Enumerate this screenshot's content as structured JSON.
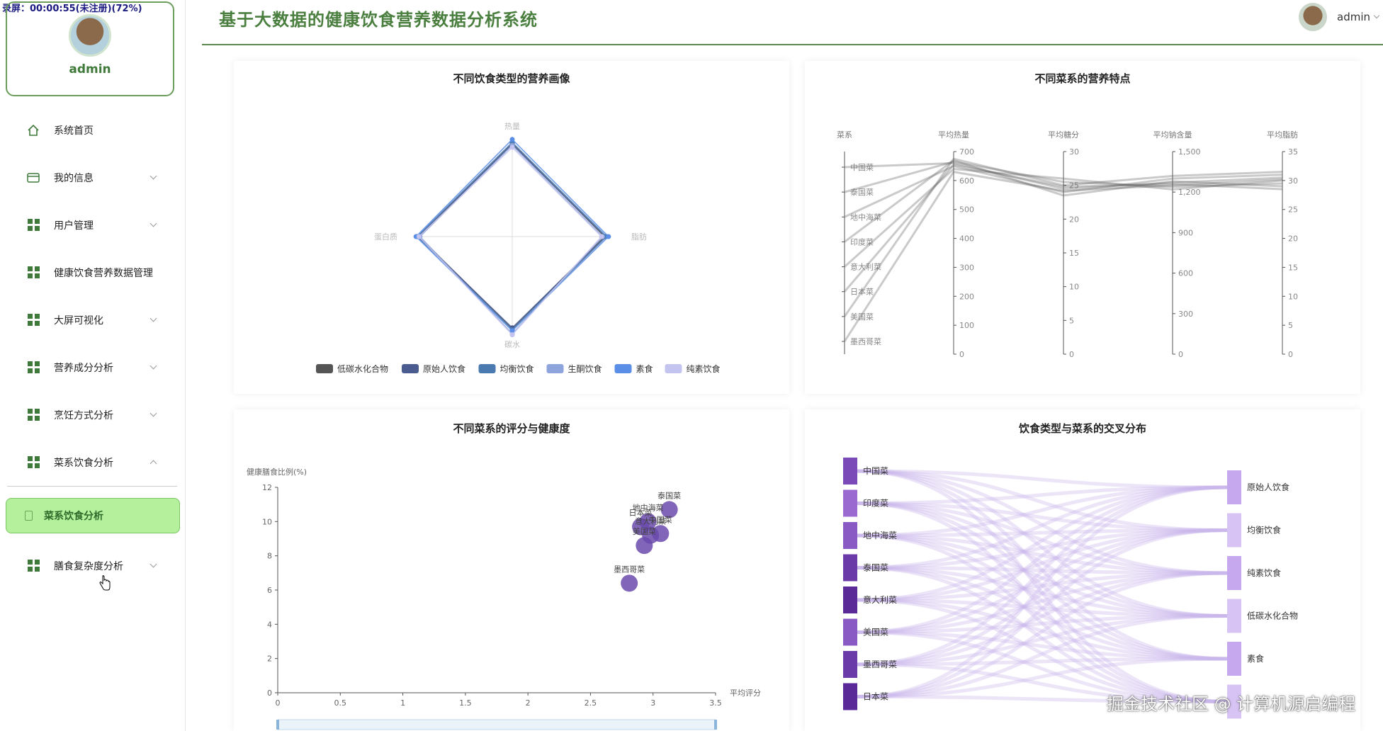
{
  "recording_overlay": "录屏：00:00:55(未注册)(72%)",
  "profile": {
    "name": "admin"
  },
  "menu": {
    "items": [
      {
        "label": "系统首页",
        "icon": "home-icon"
      },
      {
        "label": "我的信息",
        "icon": "card-icon"
      },
      {
        "label": "用户管理",
        "icon": "grid-icon"
      },
      {
        "label": "健康饮食营养数据管理",
        "icon": "grid-icon"
      },
      {
        "label": "大屏可视化",
        "icon": "grid-icon"
      },
      {
        "label": "营养成分分析",
        "icon": "grid-icon"
      },
      {
        "label": "烹饪方式分析",
        "icon": "grid-icon"
      },
      {
        "label": "菜系饮食分析",
        "icon": "grid-icon"
      },
      {
        "label": "膳食复杂度分析",
        "icon": "grid-icon"
      }
    ],
    "active_sub": "菜系饮食分析"
  },
  "header": {
    "title": "基于大数据的健康饮食营养数据分析系统",
    "user": "admin"
  },
  "watermark": "掘金技术社区 @ 计算机源启编程",
  "colors": {
    "accent": "#4a7f3f",
    "active_bg": "#b5f09c",
    "scatter": "#6a4aad"
  },
  "chart_data": [
    {
      "type": "radar",
      "title": "不同饮食类型的营养画像",
      "indicators": [
        "热量",
        "脂肪",
        "碳水",
        "蛋白质"
      ],
      "legend": [
        "低碳水化合物",
        "原始人饮食",
        "均衡饮食",
        "生酮饮食",
        "素食",
        "纯素饮食"
      ],
      "legend_colors": [
        "#555555",
        "#4a5b8f",
        "#4a7ab0",
        "#8ea4dc",
        "#5b8ee6",
        "#c4c4f0"
      ],
      "series": [
        {
          "name": "低碳水化合物",
          "values": [
            0.94,
            0.93,
            0.93,
            0.94
          ]
        },
        {
          "name": "原始人饮食",
          "values": [
            0.93,
            0.94,
            0.92,
            0.95
          ]
        },
        {
          "name": "均衡饮食",
          "values": [
            0.95,
            0.95,
            0.94,
            0.96
          ]
        },
        {
          "name": "生酮饮食",
          "values": [
            0.92,
            0.91,
            0.98,
            0.93
          ]
        },
        {
          "name": "素食",
          "values": [
            0.98,
            0.97,
            0.95,
            0.97
          ]
        },
        {
          "name": "纯素饮食",
          "values": [
            0.9,
            0.9,
            0.99,
            0.94
          ]
        }
      ]
    },
    {
      "type": "parallel",
      "title": "不同菜系的营养特点",
      "axes": [
        {
          "name": "菜系",
          "categories": [
            "中国菜",
            "泰国菜",
            "地中海菜",
            "印度菜",
            "意大利菜",
            "日本菜",
            "美国菜",
            "墨西哥菜"
          ]
        },
        {
          "name": "平均热量",
          "min": 0,
          "max": 700,
          "ticks": [
            "0",
            "100",
            "200",
            "300",
            "400",
            "500",
            "600",
            "700"
          ]
        },
        {
          "name": "平均糖分",
          "min": 0,
          "max": 30,
          "ticks": [
            "0",
            "5",
            "10",
            "15",
            "20",
            "25",
            "30"
          ]
        },
        {
          "name": "平均钠含量",
          "min": 0,
          "max": 1500,
          "ticks": [
            "0",
            "300",
            "600",
            "900",
            "1,200",
            "1,500"
          ]
        },
        {
          "name": "平均脂肪",
          "min": 0,
          "max": 35,
          "ticks": [
            "0",
            "5",
            "10",
            "15",
            "20",
            "25",
            "30",
            "35"
          ]
        }
      ],
      "lines": [
        [
          0,
          660,
          24.5,
          1270,
          30.5
        ],
        [
          1,
          665,
          25.5,
          1240,
          29.5
        ],
        [
          2,
          650,
          24,
          1300,
          31
        ],
        [
          3,
          670,
          23.5,
          1280,
          29
        ],
        [
          4,
          640,
          26,
          1220,
          30
        ],
        [
          5,
          655,
          24.8,
          1260,
          28.5
        ],
        [
          6,
          675,
          25,
          1320,
          31.5
        ],
        [
          7,
          630,
          24.2,
          1250,
          30.2
        ]
      ]
    },
    {
      "type": "scatter",
      "title": "不同菜系的评分与健康度",
      "ylabel": "健康膳食比例(%)",
      "xlabel": "平均评分",
      "xlim": [
        0,
        3.5
      ],
      "ylim": [
        0,
        12
      ],
      "xticks": [
        "0",
        "0.5",
        "1",
        "1.5",
        "2",
        "2.5",
        "3",
        "3.5"
      ],
      "yticks": [
        "0",
        "2",
        "4",
        "6",
        "8",
        "10",
        "12"
      ],
      "points": [
        {
          "label": "泰国菜",
          "x": 3.13,
          "y": 10.7
        },
        {
          "label": "地中海菜",
          "x": 2.96,
          "y": 10.0
        },
        {
          "label": "日本菜",
          "x": 2.9,
          "y": 9.7
        },
        {
          "label": "中国菜",
          "x": 3.06,
          "y": 9.3
        },
        {
          "label": "意大利菜",
          "x": 2.98,
          "y": 9.2
        },
        {
          "label": "美国菜",
          "x": 2.93,
          "y": 8.6
        },
        {
          "label": "墨西哥菜",
          "x": 2.81,
          "y": 6.4
        }
      ]
    },
    {
      "type": "sankey",
      "title": "饮食类型与菜系的交叉分布",
      "left": [
        "中国菜",
        "印度菜",
        "地中海菜",
        "泰国菜",
        "意大利菜",
        "美国菜",
        "墨西哥菜",
        "日本菜"
      ],
      "right": [
        "原始人饮食",
        "均衡饮食",
        "纯素饮食",
        "低碳水化合物",
        "素食",
        ""
      ]
    }
  ]
}
